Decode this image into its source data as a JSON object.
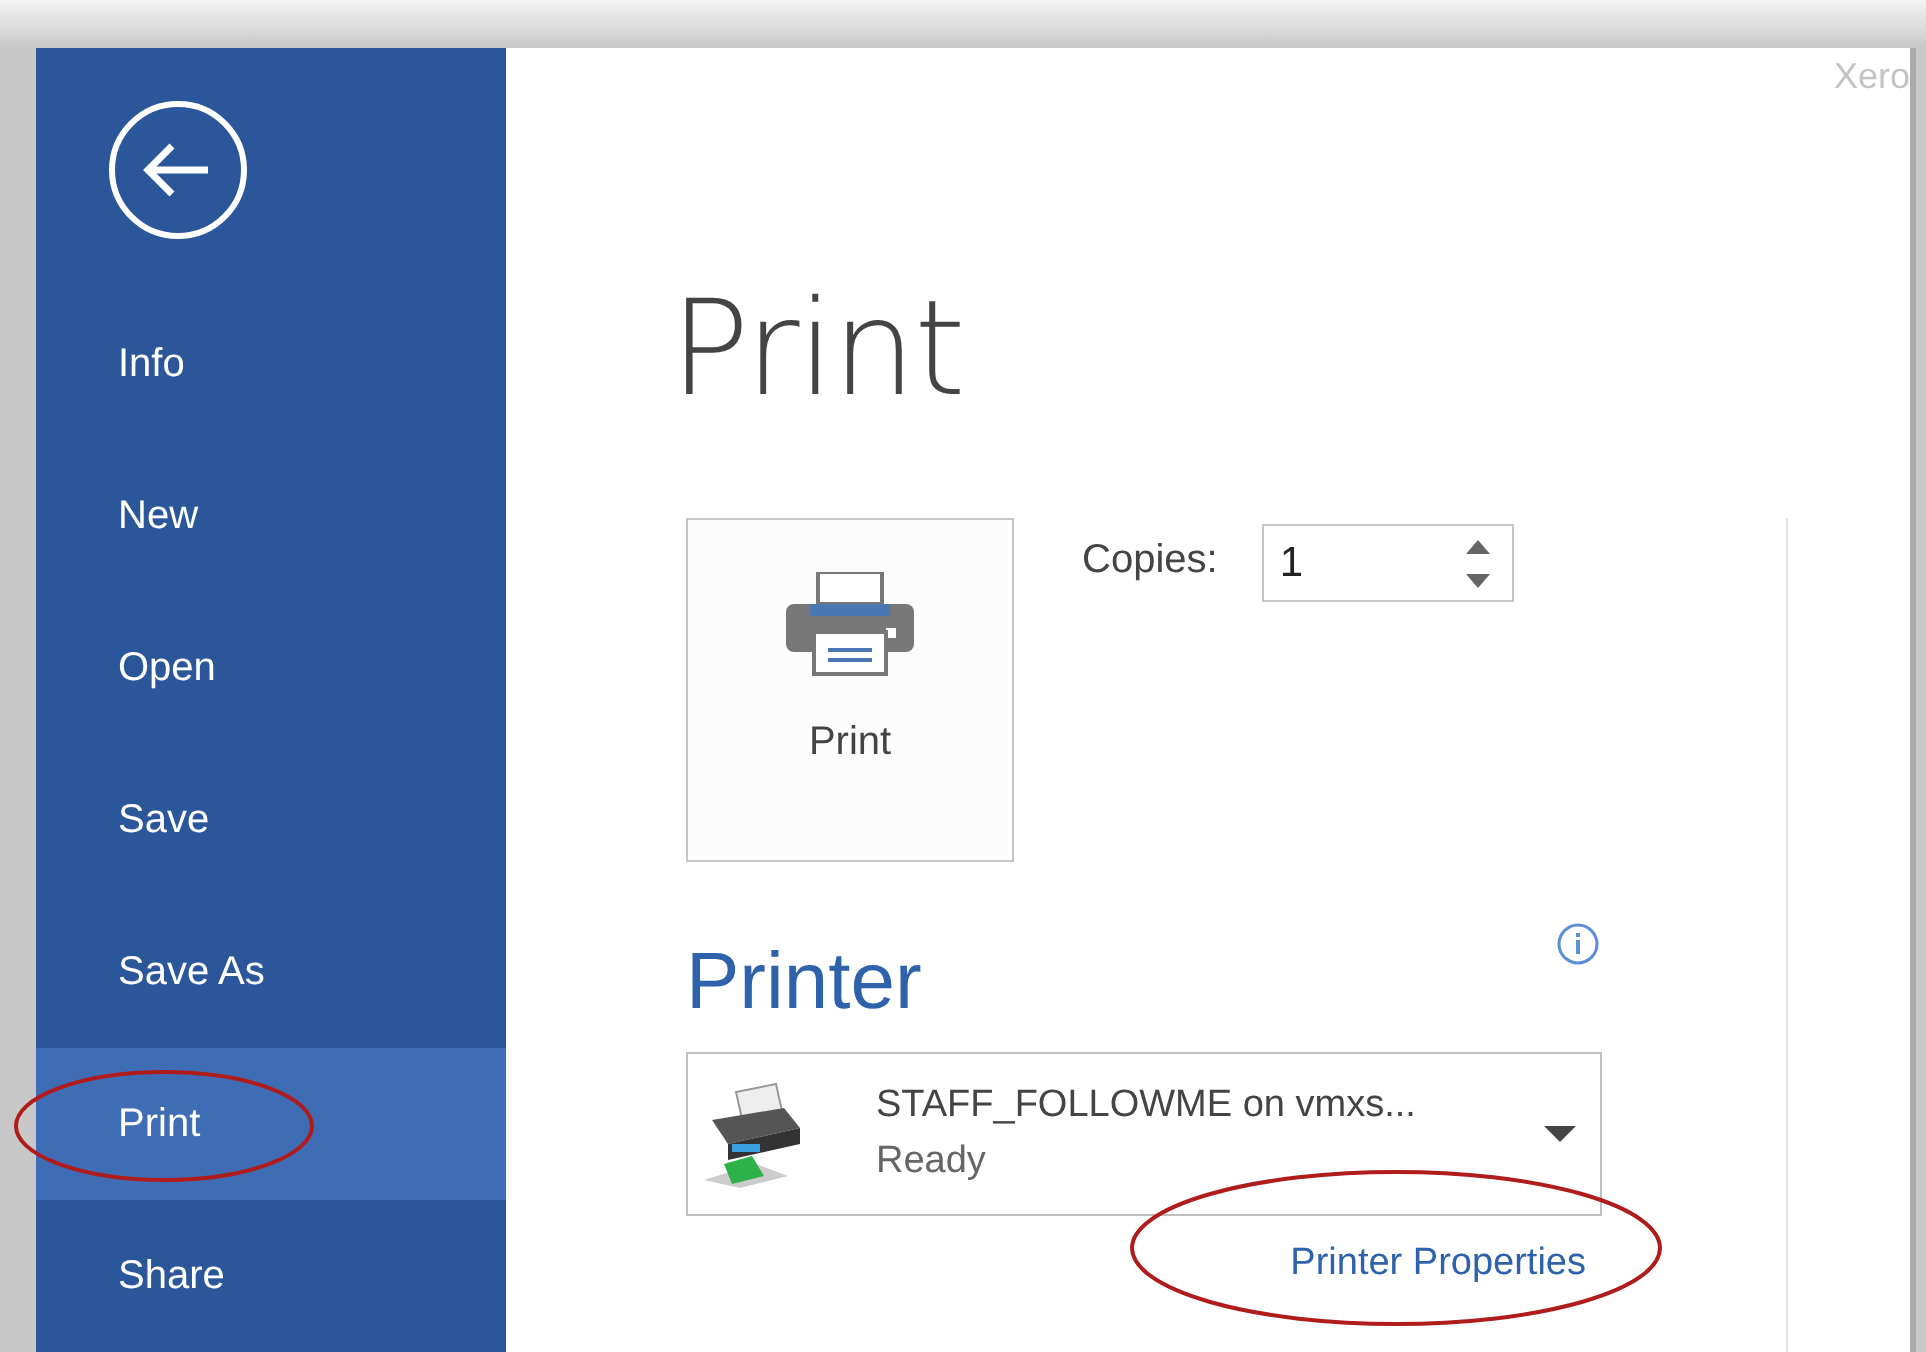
{
  "sidebar": {
    "items": [
      {
        "label": "Info",
        "selected": false
      },
      {
        "label": "New",
        "selected": false
      },
      {
        "label": "Open",
        "selected": false
      },
      {
        "label": "Save",
        "selected": false
      },
      {
        "label": "Save As",
        "selected": false
      },
      {
        "label": "Print",
        "selected": true
      },
      {
        "label": "Share",
        "selected": false
      }
    ]
  },
  "corner_text": "Xero",
  "title": "Print",
  "print_button": {
    "label": "Print"
  },
  "copies": {
    "label": "Copies:",
    "value": "1"
  },
  "printer": {
    "heading": "Printer",
    "name": "STAFF_FOLLOWME on vmxs...",
    "status": "Ready",
    "properties_link": "Printer Properties"
  }
}
